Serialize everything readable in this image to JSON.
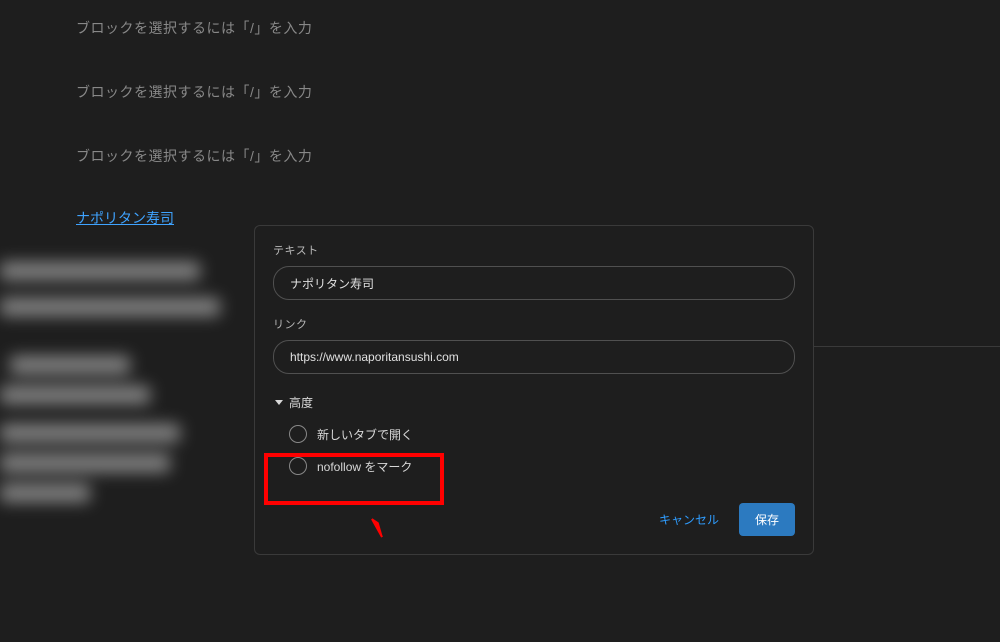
{
  "editor": {
    "placeholders": [
      "ブロックを選択するには「/」を入力",
      "ブロックを選択するには「/」を入力",
      "ブロックを選択するには「/」を入力"
    ],
    "link_text": "ナポリタン寿司"
  },
  "dialog": {
    "text_label": "テキスト",
    "text_value": "ナポリタン寿司",
    "link_label": "リンク",
    "link_value": "https://www.naporitansushi.com",
    "advanced_label": "高度",
    "toggle_new_tab": "新しいタブで開く",
    "toggle_nofollow": "nofollow をマーク",
    "cancel": "キャンセル",
    "save": "保存"
  }
}
